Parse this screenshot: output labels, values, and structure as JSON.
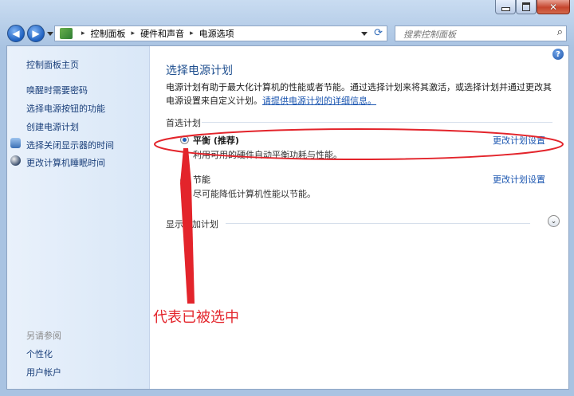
{
  "navigation": {
    "breadcrumb": [
      "控制面板",
      "硬件和声音",
      "电源选项"
    ],
    "search_placeholder": "搜索控制面板"
  },
  "sidebar": {
    "home": "控制面板主页",
    "items": [
      {
        "label": "唤醒时需要密码",
        "icon": null
      },
      {
        "label": "选择电源按钮的功能",
        "icon": null
      },
      {
        "label": "创建电源计划",
        "icon": null
      },
      {
        "label": "选择关闭显示器的时间",
        "icon": "monitor-icon"
      },
      {
        "label": "更改计算机睡眠时间",
        "icon": "moon-icon"
      }
    ],
    "see_also_heading": "另请参阅",
    "see_also": [
      "个性化",
      "用户帐户"
    ]
  },
  "main": {
    "title": "选择电源计划",
    "description": "电源计划有助于最大化计算机的性能或者节能。通过选择计划来将其激活，或选择计划并通过更改其电源设置来自定义计划。",
    "description_link": "请提供电源计划的详细信息。",
    "preferred_label": "首选计划",
    "plans": [
      {
        "name": "平衡 (推荐)",
        "desc": "利用可用的硬件自动平衡功耗与性能。",
        "selected": true,
        "change": "更改计划设置"
      },
      {
        "name": "节能",
        "desc": "尽可能降低计算机性能以节能。",
        "selected": false,
        "change": "更改计划设置"
      }
    ],
    "more_plans": "显示附加计划"
  },
  "annotation": {
    "text": "代表已被选中",
    "color": "#e3242b"
  }
}
